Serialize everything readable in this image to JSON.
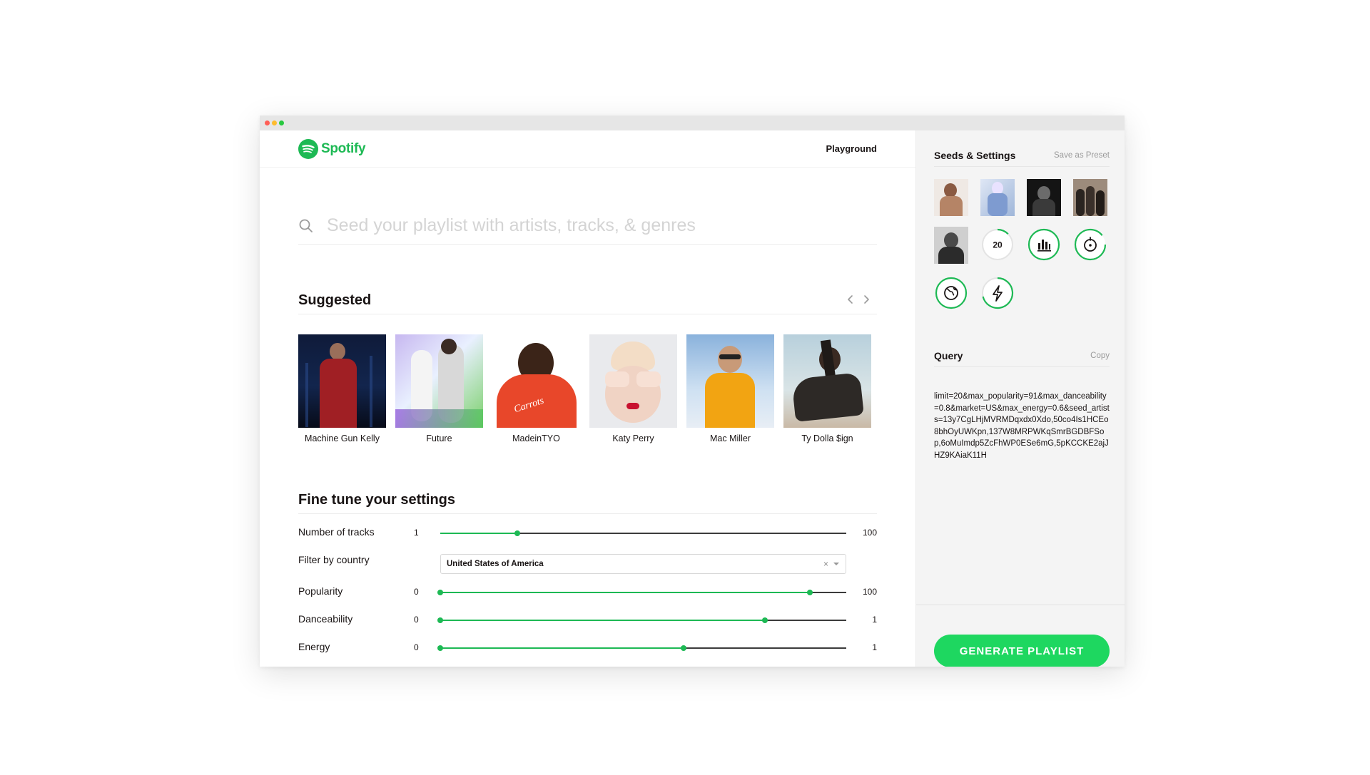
{
  "app": {
    "brand": "Spotify",
    "nav_playground": "Playground",
    "brand_color": "#1DB954"
  },
  "search": {
    "placeholder": "Seed your playlist with artists, tracks, & genres"
  },
  "suggested": {
    "title": "Suggested",
    "artists": [
      {
        "name": "Machine Gun Kelly"
      },
      {
        "name": "Future"
      },
      {
        "name": "MadeinTYO"
      },
      {
        "name": "Katy Perry"
      },
      {
        "name": "Mac Miller"
      },
      {
        "name": "Ty Dolla $ign"
      }
    ]
  },
  "settings": {
    "title": "Fine tune your settings",
    "number_of_tracks": {
      "label": "Number of tracks",
      "min": "1",
      "max": "100",
      "value_fraction": 0.19
    },
    "filter_by_country": {
      "label": "Filter by country",
      "value": "United States of America"
    },
    "popularity": {
      "label": "Popularity",
      "min": "0",
      "max": "100",
      "value_fraction": 0.91
    },
    "danceability": {
      "label": "Danceability",
      "min": "0",
      "max": "1",
      "value_fraction": 0.8
    },
    "energy": {
      "label": "Energy",
      "min": "0",
      "max": "1",
      "value_fraction": 0.6
    }
  },
  "sidebar": {
    "seeds_title": "Seeds & Settings",
    "save_preset": "Save as Preset",
    "limit_badge": "20",
    "dial_icons": [
      "bars-icon",
      "dial-icon",
      "globe-icon",
      "bolt-icon"
    ],
    "query_title": "Query",
    "copy_label": "Copy",
    "query": "limit=20&max_popularity=91&max_danceability=0.8&market=US&max_energy=0.6&seed_artists=13y7CgLHjMVRMDqxdx0Xdo,50co4Is1HCEo8bhOyUWKpn,137W8MRPWKqSmrBGDBFSop,6oMuImdp5ZcFhWP0ESe6mG,5pKCCKE2ajJHZ9KAiaK11H",
    "generate_label": "GENERATE PLAYLIST"
  }
}
